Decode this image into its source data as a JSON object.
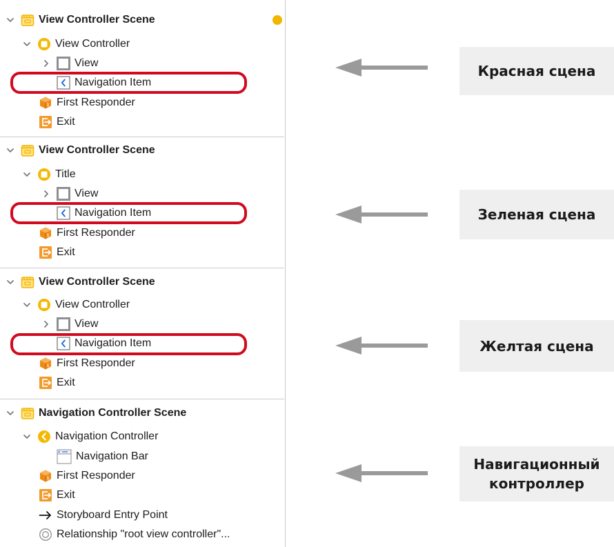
{
  "outline": {
    "scenes": [
      {
        "title": "View Controller Scene",
        "controller": "View Controller",
        "view": "View",
        "nav_item": "Navigation Item",
        "first_responder": "First Responder",
        "exit": "Exit"
      },
      {
        "title": "View Controller Scene",
        "controller": "Title",
        "view": "View",
        "nav_item": "Navigation Item",
        "first_responder": "First Responder",
        "exit": "Exit"
      },
      {
        "title": "View Controller Scene",
        "controller": "View Controller",
        "view": "View",
        "nav_item": "Navigation Item",
        "first_responder": "First Responder",
        "exit": "Exit"
      },
      {
        "title": "Navigation Controller Scene",
        "controller": "Navigation Controller",
        "nav_bar": "Navigation Bar",
        "nav_bar_icon_text": "Title",
        "first_responder": "First Responder",
        "exit": "Exit",
        "entry_point": "Storyboard Entry Point",
        "relationship": "Relationship \"root view controller\"..."
      }
    ]
  },
  "annotations": [
    "Красная сцена",
    "Зеленая сцена",
    "Желтая сцена",
    "Навигационный\nконтроллер"
  ],
  "colors": {
    "highlight": "#d10a1f",
    "scene_icon": "#f2b600",
    "responder_icon": "#ef8a17",
    "exit_icon": "#f29a2c",
    "arrow": "#9a9a9a",
    "annotation_bg": "#efefef"
  },
  "icons": {
    "scene": "storyboard-scene-icon",
    "controller": "view-controller-icon",
    "view": "view-icon",
    "nav_item": "navigation-item-icon",
    "first_responder": "first-responder-icon",
    "exit": "exit-icon"
  }
}
